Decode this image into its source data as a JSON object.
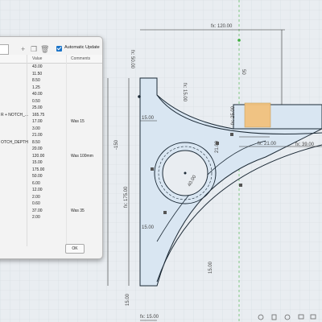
{
  "colors": {
    "canvas_bg": "#e9edf1",
    "grid": "#d4dae0",
    "profile_fill": "#d9e6f2",
    "sketch_line": "#1c2a36",
    "constraint_dim": "#333333",
    "highlight": "#f2c27e",
    "checkbox": "#1a73c8",
    "axis_green": "#3cae3c"
  },
  "dialog": {
    "auto_update_label": "Automatic Update",
    "icons": [
      "add-icon",
      "copy-icon",
      "delete-icon"
    ],
    "columns": {
      "value": "Value",
      "comments": "Comments"
    },
    "rows": [
      {
        "name": "",
        "value": "43.00",
        "comment": ""
      },
      {
        "name": "",
        "value": "11.50",
        "comment": ""
      },
      {
        "name": "",
        "value": "8.50",
        "comment": ""
      },
      {
        "name": "",
        "value": "1.25",
        "comment": ""
      },
      {
        "name": "",
        "value": "40.00",
        "comment": ""
      },
      {
        "name": "",
        "value": "0.50",
        "comment": ""
      },
      {
        "name": "",
        "value": "25.00",
        "comment": ""
      },
      {
        "name": "R + NOTCH_...",
        "value": "165.75",
        "comment": ""
      },
      {
        "name": "",
        "value": "17.00",
        "comment": "Was 15"
      },
      {
        "name": "",
        "value": "3.00",
        "comment": ""
      },
      {
        "name": "",
        "value": "21.00",
        "comment": ""
      },
      {
        "name": "OTCH_DEPTH",
        "value": "8.50",
        "comment": ""
      },
      {
        "name": "",
        "value": "20.00",
        "comment": ""
      },
      {
        "name": "",
        "value": "120.00",
        "comment": "Was 100mm"
      },
      {
        "name": "",
        "value": "15.00",
        "comment": ""
      },
      {
        "name": "",
        "value": "175.00",
        "comment": ""
      },
      {
        "name": "",
        "value": "50.00",
        "comment": ""
      },
      {
        "name": "",
        "value": "6.00",
        "comment": ""
      },
      {
        "name": "",
        "value": "12.00",
        "comment": ""
      },
      {
        "name": "",
        "value": "2.00",
        "comment": ""
      },
      {
        "name": "",
        "value": "0.60",
        "comment": ""
      },
      {
        "name": "",
        "value": "37.00",
        "comment": "Was 35"
      },
      {
        "name": "",
        "value": "2.00",
        "comment": ""
      }
    ],
    "ok_label": "OK"
  },
  "dimensions": {
    "top_width": "fx: 120.00",
    "left_height_top": "fx: 50.00",
    "notch_15": "fx: 15.00",
    "label_15_a": "15.00",
    "label_15_b": "15.00",
    "label_15_c": "15.00",
    "left_total": "fx: 175.00",
    "neg_150": "-150",
    "axis_50": "50",
    "fx_25": "fx: 25.00",
    "fx_21": "fx: 21.00",
    "fx_39": "fx: 39.00",
    "fx_21b": "21.00",
    "hole_dia": "40.00",
    "bottom_15": "fx: 15.00",
    "bottom_15b": "15.00"
  }
}
